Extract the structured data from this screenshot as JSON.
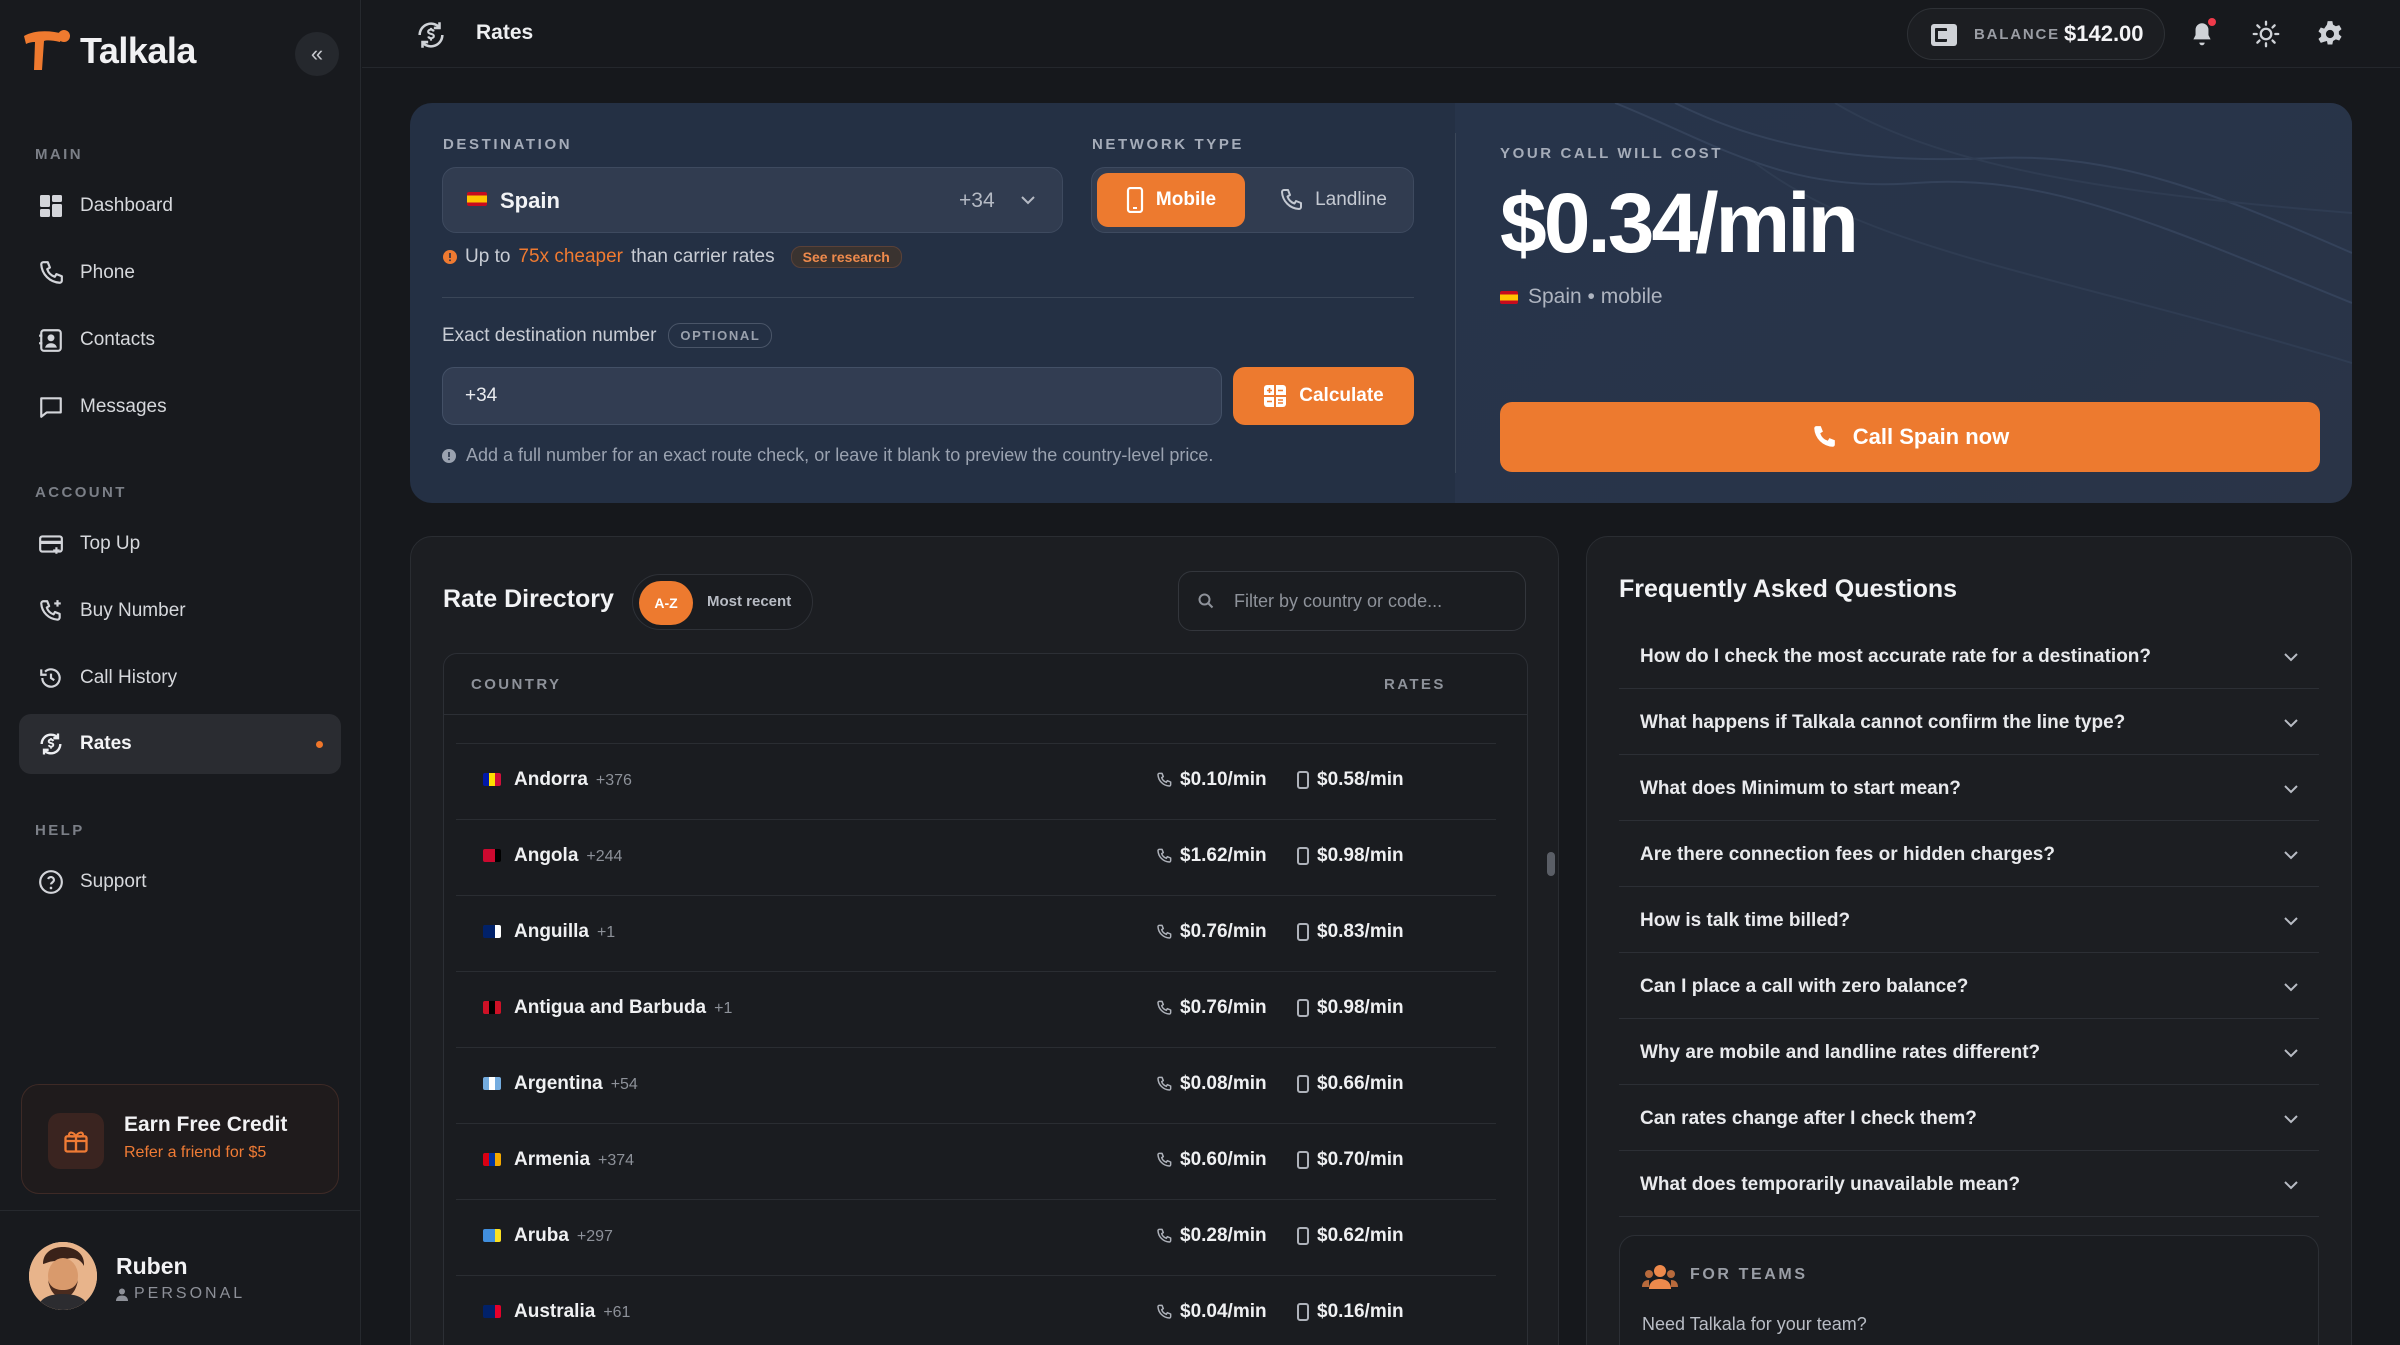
{
  "app": {
    "name": "Talkala"
  },
  "sidebar": {
    "sections": {
      "main": "MAIN",
      "account": "ACCOUNT",
      "help": "HELP"
    },
    "main_items": [
      {
        "label": "Dashboard",
        "icon": "dashboard-icon"
      },
      {
        "label": "Phone",
        "icon": "phone-icon"
      },
      {
        "label": "Contacts",
        "icon": "contacts-icon"
      },
      {
        "label": "Messages",
        "icon": "messages-icon"
      }
    ],
    "account_items": [
      {
        "label": "Top Up",
        "icon": "card-icon"
      },
      {
        "label": "Buy Number",
        "icon": "phone-plus-icon"
      },
      {
        "label": "Call History",
        "icon": "history-icon"
      },
      {
        "label": "Rates",
        "icon": "rates-icon",
        "active": true
      }
    ],
    "help_items": [
      {
        "label": "Support",
        "icon": "help-circle-icon"
      }
    ],
    "promo": {
      "title": "Earn Free Credit",
      "subtitle": "Refer a friend for $5"
    },
    "user": {
      "name": "Ruben",
      "plan": "PERSONAL"
    }
  },
  "topbar": {
    "title": "Rates",
    "balance_label": "BALANCE",
    "balance_value": "$142.00"
  },
  "calculator": {
    "destination_label": "DESTINATION",
    "destination": {
      "name": "Spain",
      "code": "+34"
    },
    "network_label": "NETWORK TYPE",
    "network_options": {
      "mobile": "Mobile",
      "landline": "Landline"
    },
    "network_selected": "Mobile",
    "cheaper": {
      "prefix": "Up to",
      "highlight": "75x cheaper",
      "suffix": "than carrier rates",
      "link": "See research"
    },
    "exact_label": "Exact destination number",
    "optional_badge": "OPTIONAL",
    "number_value": "+34",
    "calculate_label": "Calculate",
    "hint": "Add a full number for an exact route check, or leave it blank to preview the country-level price.",
    "cost_label": "YOUR CALL WILL COST",
    "cost_value": "$0.34/min",
    "cost_sub": "Spain • mobile",
    "call_button": "Call Spain now"
  },
  "directory": {
    "title": "Rate Directory",
    "sort_options": {
      "az": "A-Z",
      "recent": "Most recent"
    },
    "filter_placeholder": "Filter by country or code...",
    "columns": {
      "country": "COUNTRY",
      "rates": "RATES"
    },
    "rows": [
      {
        "country": "Andorra",
        "code": "+376",
        "landline": "$0.10/min",
        "mobile": "$0.58/min",
        "flag": [
          "#0018a8",
          "#fedf00",
          "#d0103a"
        ]
      },
      {
        "country": "Angola",
        "code": "+244",
        "landline": "$1.62/min",
        "mobile": "$0.98/min",
        "flag": [
          "#cc092f",
          "#cc092f",
          "#000000"
        ]
      },
      {
        "country": "Anguilla",
        "code": "+1",
        "landline": "$0.76/min",
        "mobile": "$0.83/min",
        "flag": [
          "#012169",
          "#012169",
          "#ffffff"
        ]
      },
      {
        "country": "Antigua and Barbuda",
        "code": "+1",
        "landline": "$0.76/min",
        "mobile": "$0.98/min",
        "flag": [
          "#ce1126",
          "#000000",
          "#ce1126"
        ]
      },
      {
        "country": "Argentina",
        "code": "+54",
        "landline": "$0.08/min",
        "mobile": "$0.66/min",
        "flag": [
          "#74acdf",
          "#ffffff",
          "#74acdf"
        ]
      },
      {
        "country": "Armenia",
        "code": "+374",
        "landline": "$0.60/min",
        "mobile": "$0.70/min",
        "flag": [
          "#d90012",
          "#0033a0",
          "#f2a800"
        ]
      },
      {
        "country": "Aruba",
        "code": "+297",
        "landline": "$0.28/min",
        "mobile": "$0.62/min",
        "flag": [
          "#418fde",
          "#418fde",
          "#fbe122"
        ]
      },
      {
        "country": "Australia",
        "code": "+61",
        "landline": "$0.04/min",
        "mobile": "$0.16/min",
        "flag": [
          "#012169",
          "#012169",
          "#e4002b"
        ]
      }
    ]
  },
  "faq": {
    "title": "Frequently Asked Questions",
    "items": [
      "How do I check the most accurate rate for a destination?",
      "What happens if Talkala cannot confirm the line type?",
      "What does Minimum to start mean?",
      "Are there connection fees or hidden charges?",
      "How is talk time billed?",
      "Can I place a call with zero balance?",
      "Why are mobile and landline rates different?",
      "Can rates change after I check them?",
      "What does temporarily unavailable mean?"
    ],
    "teams_label": "FOR TEAMS",
    "teams_text": "Need Talkala for your team?"
  },
  "colors": {
    "accent": "#ed7a2f",
    "background": "#16181c",
    "hero": "#243044"
  }
}
